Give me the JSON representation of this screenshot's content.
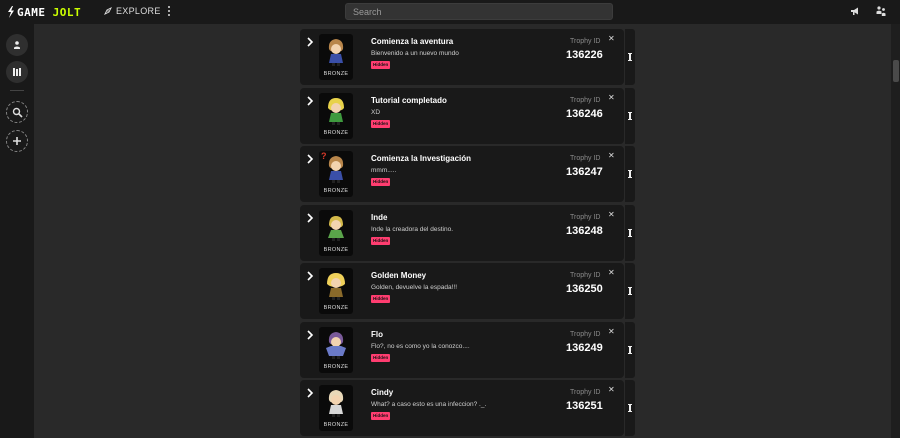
{
  "header": {
    "logo_prefix": "GAME",
    "logo_suffix": "JOLT",
    "explore_label": "EXPLORE",
    "search_placeholder": "Search"
  },
  "colors": {
    "accent": "#ccff00",
    "badge": "#ff3d70",
    "card_bg": "#191919",
    "page_bg": "#292929"
  },
  "icons": {
    "explore": "compass-icon",
    "menu": "kebab-menu-icon",
    "left_top": "megaphone-icon",
    "right_top": "people-icon"
  },
  "trophy_label": "Trophy ID",
  "trophies": [
    {
      "title": "Comienza la aventura",
      "description": "Bienvenido a un nuevo mundo",
      "badge": "Hidden",
      "tier": "BRONZE",
      "trophy_id": "136226"
    },
    {
      "title": "Tutorial completado",
      "description": "XD",
      "badge": "Hidden",
      "tier": "BRONZE",
      "trophy_id": "136246"
    },
    {
      "title": "Comienza la Investigación",
      "description": "mmm.....",
      "badge": "Hidden",
      "tier": "BRONZE",
      "trophy_id": "136247"
    },
    {
      "title": "Inde",
      "description": "Inde la creadora del destino.",
      "badge": "Hidden",
      "tier": "BRONZE",
      "trophy_id": "136248"
    },
    {
      "title": "Golden Money",
      "description": "Golden, devuelve la espada!!!",
      "badge": "Hidden",
      "tier": "BRONZE",
      "trophy_id": "136250"
    },
    {
      "title": "Flo",
      "description": "Flo?, no es como yo la conozco....",
      "badge": "Hidden",
      "tier": "BRONZE",
      "trophy_id": "136249"
    },
    {
      "title": "Cindy",
      "description": "What? a caso esto es una infeccion? ._.",
      "badge": "Hidden",
      "tier": "BRONZE",
      "trophy_id": "136251"
    }
  ]
}
